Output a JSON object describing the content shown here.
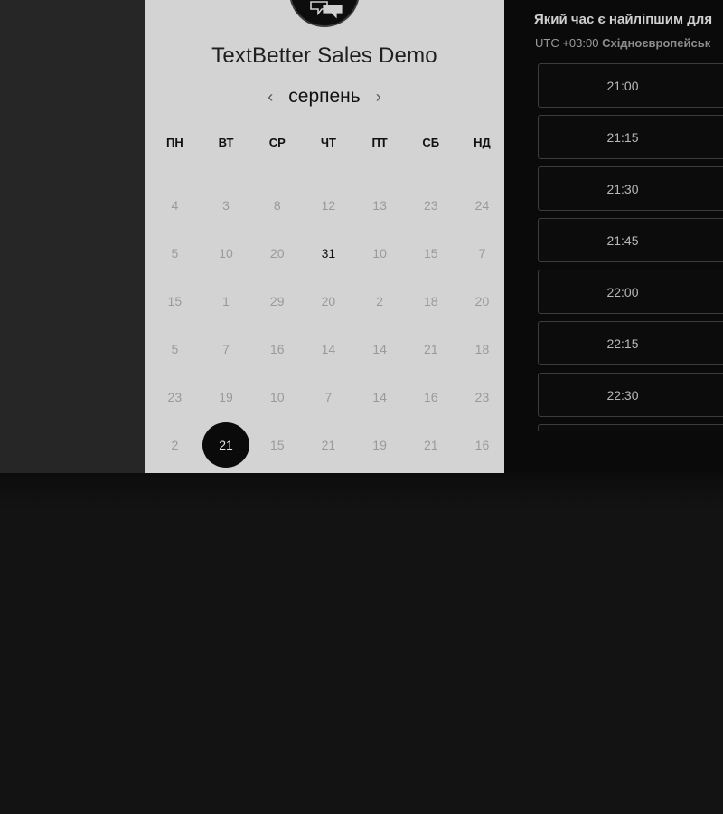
{
  "event": {
    "title": "TextBetter Sales Demo"
  },
  "calendar": {
    "month": "серпень",
    "prev_icon": "chevron-left-icon",
    "next_icon": "chevron-right-icon",
    "weekdays": [
      "ПН",
      "ВТ",
      "СР",
      "ЧТ",
      "ПТ",
      "СБ",
      "НД"
    ],
    "weeks": [
      [
        "4",
        "3",
        "8",
        "12",
        "13",
        "23",
        "24"
      ],
      [
        "5",
        "10",
        "20",
        "31",
        "10",
        "15",
        "7"
      ],
      [
        "15",
        "1",
        "29",
        "20",
        "2",
        "18",
        "20"
      ],
      [
        "5",
        "7",
        "16",
        "14",
        "14",
        "21",
        "18"
      ],
      [
        "23",
        "19",
        "10",
        "7",
        "14",
        "16",
        "23"
      ],
      [
        "2",
        "21",
        "15",
        "21",
        "19",
        "21",
        "16"
      ]
    ],
    "available_day": "31",
    "selected_day": "21"
  },
  "times": {
    "question": "Який час є найліпшим для",
    "timezone_offset": "UTC +03:00",
    "timezone_name": "Східноєвропейськ",
    "slots": [
      "21:00",
      "21:15",
      "21:30",
      "21:45",
      "22:00",
      "22:15",
      "22:30",
      ""
    ]
  },
  "colors": {
    "panel_light": "#d3d3d3",
    "panel_dark": "#0a0a0a",
    "selected": "#0a0a0a"
  }
}
